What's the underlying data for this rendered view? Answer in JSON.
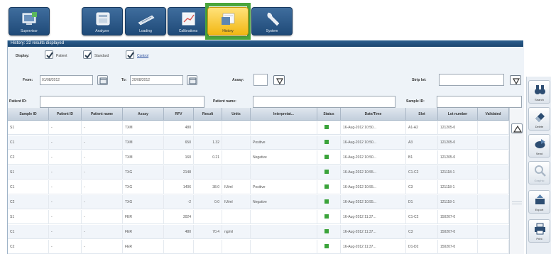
{
  "toolbar": {
    "buttons": [
      {
        "label": "Supervisor",
        "icon": "supervisor-icon"
      },
      {
        "label": "Analyzer",
        "icon": "analyzer-icon"
      },
      {
        "label": "Loading",
        "icon": "loading-icon"
      },
      {
        "label": "Calibrations",
        "icon": "calibrations-icon"
      },
      {
        "label": "History",
        "icon": "history-icon",
        "active": true
      },
      {
        "label": "System",
        "icon": "wrench-icon"
      }
    ]
  },
  "history_header": "History: 22 results displayed",
  "filters": {
    "display_label": "Display:",
    "display_options": [
      {
        "label": "Patient",
        "checked": true
      },
      {
        "label": "Standard",
        "checked": true
      },
      {
        "label": "Control",
        "checked": true
      }
    ],
    "from_label": "From:",
    "from_value": "01/08/2012",
    "to_label": "To:",
    "to_value": "20/08/2012",
    "assay_label": "Assay:",
    "assay_value": "",
    "strip_label": "Strip lot:",
    "strip_value": "",
    "patient_id_label": "Patient ID:",
    "patient_id_value": "",
    "patient_name_label": "Patient name:",
    "patient_name_value": "",
    "sample_id_label": "Sample ID:",
    "sample_id_value": ""
  },
  "table": {
    "columns": [
      "Sample ID",
      "Patient ID",
      "Patient name",
      "Assay",
      "RFV",
      "Result",
      "Units",
      "Interpretat...",
      "Status",
      "Date/Time",
      "Slot",
      "Lot number",
      "Validated"
    ],
    "rows": [
      [
        "S1",
        "-",
        "-",
        "TXM",
        "480",
        "",
        "",
        "",
        "ok",
        "16-Aug-2012 10:50...",
        "A1-A2",
        "121205-0",
        ""
      ],
      [
        "C1",
        "-",
        "-",
        "TXM",
        "650",
        "1.32",
        "",
        "Positive",
        "ok",
        "16-Aug-2012 10:50...",
        "A3",
        "121205-0",
        ""
      ],
      [
        "C2",
        "-",
        "-",
        "TXM",
        "160",
        "0.21",
        "",
        "Negative",
        "ok",
        "16-Aug-2012 10:50...",
        "B1",
        "121205-0",
        ""
      ],
      [
        "S1",
        "-",
        "-",
        "TXG",
        "2148",
        "",
        "",
        "",
        "ok",
        "16-Aug-2012 10:55...",
        "C1-C2",
        "121118-1",
        ""
      ],
      [
        "C1",
        "-",
        "-",
        "TXG",
        "1406",
        "38.0",
        "IU/ml",
        "Positive",
        "ok",
        "16-Aug-2012 10:55...",
        "C3",
        "121118-1",
        ""
      ],
      [
        "C2",
        "-",
        "-",
        "TXG",
        "-2",
        "0.0",
        "IU/ml",
        "Negative",
        "ok",
        "16-Aug-2012 10:55...",
        "D1",
        "121118-1",
        ""
      ],
      [
        "S1",
        "-",
        "-",
        "FER",
        "3024",
        "",
        "",
        "",
        "ok",
        "16-Aug-2012 11:37...",
        "C1-C2",
        "150207-0",
        ""
      ],
      [
        "C1",
        "-",
        "-",
        "FER",
        "480",
        "70.4",
        "ng/ml",
        "",
        "ok",
        "16-Aug-2012 11:37...",
        "C3",
        "150207-0",
        ""
      ],
      [
        "C2",
        "-",
        "-",
        "FER",
        "",
        "",
        "",
        "",
        "ok",
        "16-Aug-2012 11:37...",
        "D1-D2",
        "150207-0",
        ""
      ]
    ]
  },
  "side_toolbar": [
    {
      "label": "Search",
      "icon": "binoculars-icon"
    },
    {
      "label": "Delete",
      "icon": "eraser-icon"
    },
    {
      "label": "Send",
      "icon": "send-icon"
    },
    {
      "label": "Graphic",
      "icon": "magnifier-icon",
      "disabled": true
    },
    {
      "label": "Export",
      "icon": "export-icon"
    },
    {
      "label": "Print",
      "icon": "printer-icon"
    }
  ],
  "colors": {
    "header_blue": "#1f4a78",
    "active_yellow": "#f2b713",
    "highlight_green": "#4aa53c",
    "status_green": "#3aa33a"
  }
}
